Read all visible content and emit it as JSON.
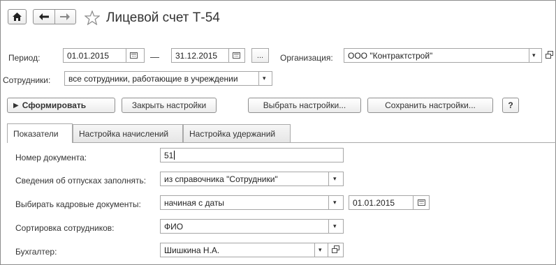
{
  "header": {
    "home_icon": "home-icon",
    "back_icon": "arrow-left-icon",
    "forward_icon": "arrow-right-icon",
    "favorite_icon": "star-icon",
    "title": "Лицевой счет Т-54"
  },
  "filters": {
    "period_label": "Период:",
    "period_from": "01.01.2015",
    "dash": "—",
    "period_to": "31.12.2015",
    "ellipsis": "...",
    "org_label": "Организация:",
    "org_value": "ООО \"Контрактстрой\"",
    "employees_label": "Сотрудники:",
    "employees_value": "все сотрудники, работающие в учреждении"
  },
  "toolbar": {
    "generate": "Сформировать",
    "close_settings": "Закрыть настройки",
    "select_settings": "Выбрать настройки...",
    "save_settings": "Сохранить настройки...",
    "help": "?"
  },
  "tabs": [
    {
      "label": "Показатели"
    },
    {
      "label": "Настройка начислений"
    },
    {
      "label": "Настройка удержаний"
    }
  ],
  "form": {
    "doc_number_label": "Номер документа:",
    "doc_number_value": "51",
    "vacation_label": "Сведения об отпусках заполнять:",
    "vacation_value": "из справочника \"Сотрудники\"",
    "hr_docs_label": "Выбирать кадровые документы:",
    "hr_docs_value": "начиная с даты",
    "hr_docs_date": "01.01.2015",
    "sort_label": "Сортировка сотрудников:",
    "sort_value": "ФИО",
    "accountant_label": "Бухгалтер:",
    "accountant_value": "Шишкина Н.А."
  }
}
